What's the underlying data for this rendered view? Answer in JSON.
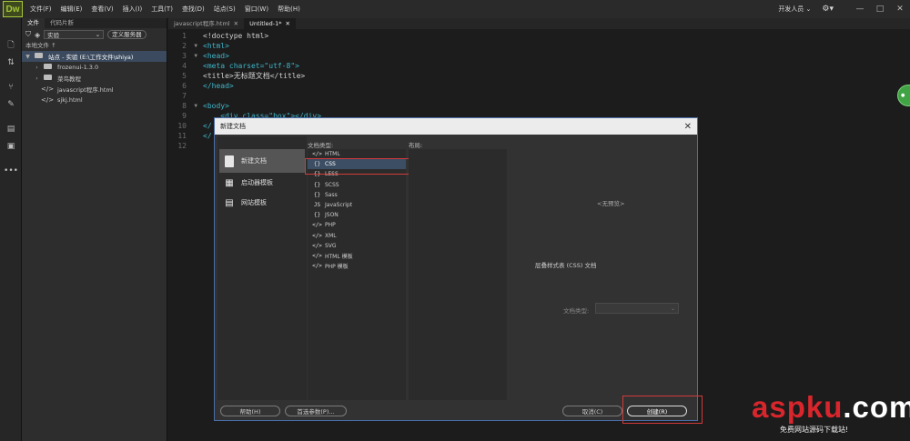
{
  "app": {
    "logo": "Dw",
    "menu": [
      "文件(F)",
      "编辑(E)",
      "查看(V)",
      "插入(I)",
      "工具(T)",
      "查找(D)",
      "站点(S)",
      "窗口(W)",
      "帮助(H)"
    ],
    "workspace": "开发人员 ⌄",
    "window_controls": [
      "—",
      "□",
      "✕"
    ]
  },
  "toolstrip": {
    "icons": [
      "file-icon",
      "arrows-icon",
      "branch-icon",
      "brush-icon",
      "chat-icon",
      "book-icon",
      "more-icon"
    ],
    "more_label": "•••"
  },
  "files_panel": {
    "tabs": [
      "文件",
      "代码片断"
    ],
    "site_select": "实验",
    "define_server": "定义服务器",
    "local_files": "本地文件 ↑",
    "tree": [
      {
        "label": "站点 - 实验 (E:\\工作文件\\shiya)",
        "type": "site",
        "expanded": true,
        "selected": true
      },
      {
        "label": "frozenui-1.3.0",
        "type": "folder"
      },
      {
        "label": "菜鸟教程",
        "type": "folder"
      },
      {
        "label": "javascript程序.html",
        "type": "html"
      },
      {
        "label": "sjkj.html",
        "type": "html"
      }
    ]
  },
  "editor": {
    "tabs": [
      {
        "label": "javascript程序.html",
        "close": "✕"
      },
      {
        "label": "Untitled-1*",
        "close": "✕"
      }
    ],
    "line_numbers": [
      "1",
      "2",
      "3",
      "4",
      "5",
      "6",
      "7",
      "8",
      "9",
      "10",
      "11",
      "12"
    ],
    "lines": [
      "<!doctype html>",
      "<html>",
      "<head>",
      "<meta charset=\"utf-8\">",
      "<title>无标题文档</title>",
      "</head>",
      "",
      "<body>",
      "    <div class=\"box\"></div>",
      "</",
      "</",
      ""
    ]
  },
  "dialog": {
    "title": "新建文档",
    "close": "✕",
    "categories": [
      "新建文档",
      "启动器模板",
      "网站模板"
    ],
    "doc_type_label": "文档类型:",
    "doc_types": [
      "HTML",
      "CSS",
      "LESS",
      "SCSS",
      "Sass",
      "JavaScript",
      "JSON",
      "PHP",
      "XML",
      "SVG",
      "HTML 模板",
      "PHP 模板"
    ],
    "doc_type_icons": [
      "</>",
      "{}",
      "{}",
      "{}",
      "{}",
      "JS",
      "{}",
      "</>",
      "</>",
      "</>",
      "</>",
      "</>"
    ],
    "selected_type": "CSS",
    "layout_label": "布局:",
    "preview_text": "<无预览>",
    "description": "层叠样式表 (CSS) 文档",
    "doctype_field_label": "文档类型:",
    "doctype_field_arrow": "⌄",
    "buttons": {
      "help": "帮助(H)",
      "preferences": "首选参数(P)...",
      "cancel": "取消(C)",
      "create": "创建(R)"
    }
  },
  "watermark": {
    "brand": "aspku",
    "suffix": ".com",
    "tagline": "免费网站源码下载站!"
  },
  "colors": {
    "accent_selection": "#3c4e64",
    "highlight_box": "#d23a3a",
    "tag": "#3fb5c9",
    "string": "#e3b24a"
  }
}
